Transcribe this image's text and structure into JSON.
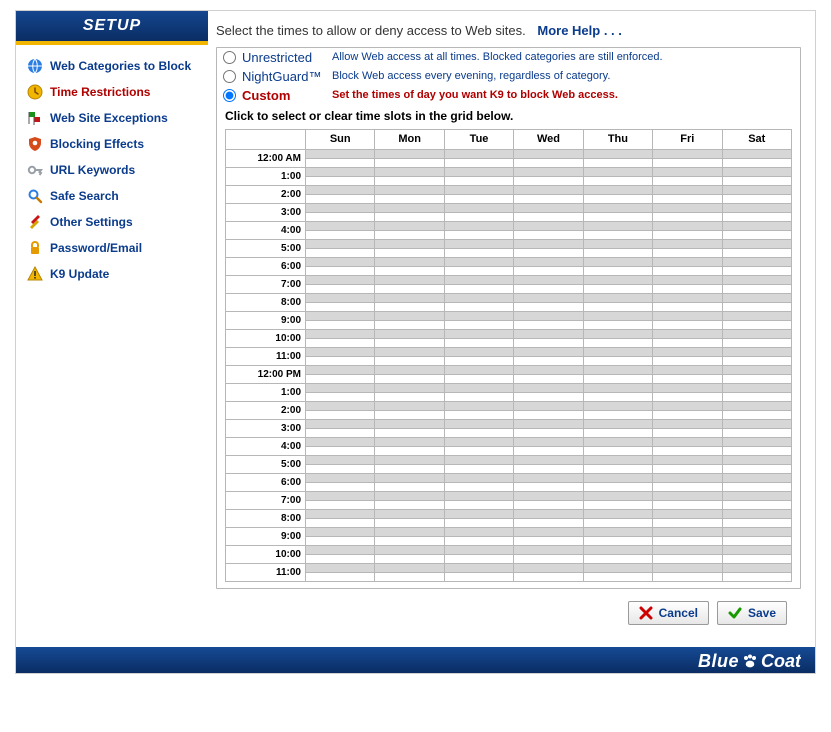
{
  "sidebar": {
    "title": "SETUP",
    "items": [
      {
        "label": "Web Categories to Block",
        "icon": "globe-icon",
        "active": false
      },
      {
        "label": "Time Restrictions",
        "icon": "clock-icon",
        "active": true
      },
      {
        "label": "Web Site Exceptions",
        "icon": "flags-icon",
        "active": false
      },
      {
        "label": "Blocking Effects",
        "icon": "shield-icon",
        "active": false
      },
      {
        "label": "URL Keywords",
        "icon": "key-icon",
        "active": false
      },
      {
        "label": "Safe Search",
        "icon": "search-icon",
        "active": false
      },
      {
        "label": "Other Settings",
        "icon": "tools-icon",
        "active": false
      },
      {
        "label": "Password/Email",
        "icon": "lock-icon",
        "active": false
      },
      {
        "label": "K9 Update",
        "icon": "warning-icon",
        "active": false
      }
    ]
  },
  "main": {
    "instruction": "Select the times to allow or deny access to Web sites.",
    "more_help": "More Help . . .",
    "options": [
      {
        "id": "unrestricted",
        "name": "Unrestricted",
        "desc": "Allow Web access at all times. Blocked categories are still enforced.",
        "selected": false
      },
      {
        "id": "nightguard",
        "name": "NightGuard™",
        "desc": "Block Web access every evening, regardless of category.",
        "selected": false
      },
      {
        "id": "custom",
        "name": "Custom",
        "desc": "Set the times of day you want K9 to block Web access.",
        "selected": true
      }
    ],
    "grid_instruction": "Click to select or clear time slots in the grid below.",
    "days": [
      "Sun",
      "Mon",
      "Tue",
      "Wed",
      "Thu",
      "Fri",
      "Sat"
    ],
    "hours": [
      "12:00 AM",
      "1:00",
      "2:00",
      "3:00",
      "4:00",
      "5:00",
      "6:00",
      "7:00",
      "8:00",
      "9:00",
      "10:00",
      "11:00",
      "12:00 PM",
      "1:00",
      "2:00",
      "3:00",
      "4:00",
      "5:00",
      "6:00",
      "7:00",
      "8:00",
      "9:00",
      "10:00",
      "11:00"
    ]
  },
  "buttons": {
    "cancel": "Cancel",
    "save": "Save"
  },
  "footer": {
    "brand_a": "Blue",
    "brand_b": "Coat"
  },
  "colors": {
    "navy": "#0a2d63",
    "link": "#0a3b8c",
    "accent_red": "#b00000",
    "accent_yellow": "#f2b600"
  }
}
